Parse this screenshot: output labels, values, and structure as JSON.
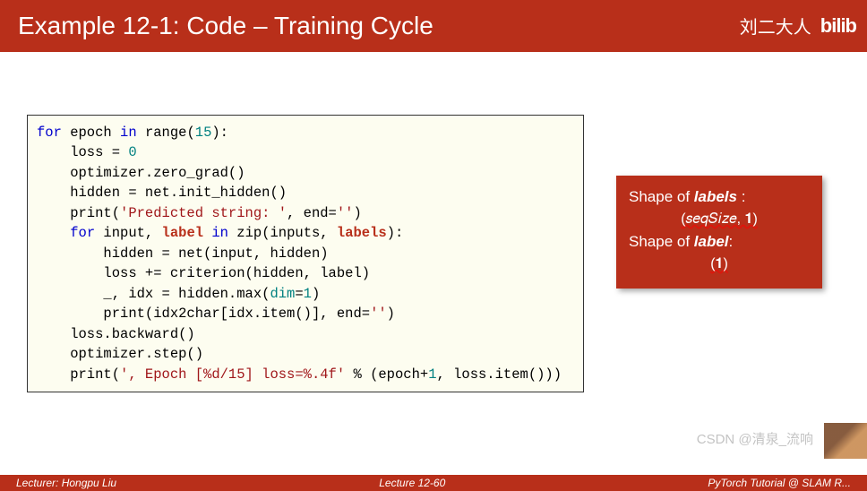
{
  "header": {
    "title": "Example 12-1: Code – Training Cycle",
    "author": "刘二大人",
    "logo": "bilib"
  },
  "code": {
    "l1a": "for",
    "l1b": " epoch ",
    "l1c": "in",
    "l1d": " range(",
    "l1e": "15",
    "l1f": "):",
    "l2": "    loss = ",
    "l2n": "0",
    "l3": "    optimizer.zero_grad()",
    "l4": "    hidden = net.init_hidden()",
    "l5a": "    print(",
    "l5b": "'Predicted string: '",
    "l5c": ", end=",
    "l5d": "''",
    "l5e": ")",
    "l6a": "    ",
    "l6b": "for",
    "l6c": " input, ",
    "l6d": "label",
    "l6e": " ",
    "l6f": "in",
    "l6g": " zip(inputs, ",
    "l6h": "labels",
    "l6i": "):",
    "l7": "        hidden = net(input, hidden)",
    "l8": "        loss += criterion(hidden, label)",
    "l9a": "        _, idx = hidden.max(",
    "l9b": "dim",
    "l9c": "=",
    "l9d": "1",
    "l9e": ")",
    "l10a": "        print(idx2char[idx.item()], end=",
    "l10b": "''",
    "l10c": ")",
    "l11": "    loss.backward()",
    "l12": "    optimizer.step()",
    "l13a": "    print(",
    "l13b": "', Epoch [%d/15] loss=%.4f'",
    "l13c": " % (epoch+",
    "l13d": "1",
    "l13e": ", loss.item()))"
  },
  "info": {
    "l1a": "Shape of ",
    "l1b": "labels",
    "l1c": " :",
    "l2": "(𝑠𝑒𝑞𝑆𝑖𝑧𝑒, 𝟏)",
    "l3a": "Shape of ",
    "l3b": "label",
    "l3c": ":",
    "l4": "(𝟏)"
  },
  "footer": {
    "left": "Lecturer: Hongpu Liu",
    "center": "Lecture 12-60",
    "right": "PyTorch Tutorial @ SLAM R..."
  },
  "watermark": "CSDN @清泉_流响"
}
